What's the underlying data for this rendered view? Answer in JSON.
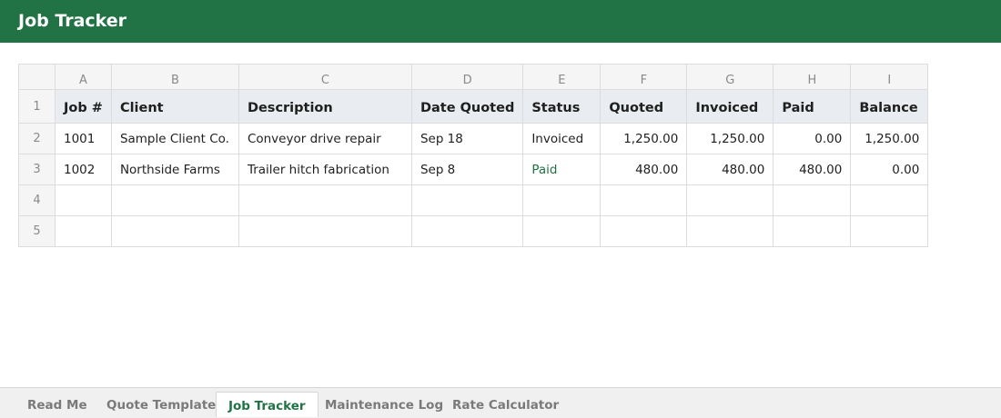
{
  "app": {
    "title": "Job Tracker"
  },
  "colors": {
    "accent": "#217346",
    "paid_status": "#217346"
  },
  "sheet": {
    "column_letters": [
      "A",
      "B",
      "C",
      "D",
      "E",
      "F",
      "G",
      "H",
      "I"
    ],
    "row_numbers": [
      "1",
      "2",
      "3",
      "4",
      "5"
    ],
    "headers": [
      "Job #",
      "Client",
      "Description",
      "Date Quoted",
      "Status",
      "Quoted",
      "Invoiced",
      "Paid",
      "Balance"
    ],
    "rows": [
      [
        "1001",
        "Sample Client Co.",
        "Conveyor drive repair",
        "Sep 18",
        "Invoiced",
        "1,250.00",
        "1,250.00",
        "0.00",
        "1,250.00"
      ],
      [
        "1002",
        "Northside Farms",
        "Trailer hitch fabrication",
        "Sep 8",
        "Paid",
        "480.00",
        "480.00",
        "480.00",
        "0.00"
      ],
      [
        "",
        "",
        "",
        "",
        "",
        "",
        "",
        "",
        ""
      ],
      [
        "",
        "",
        "",
        "",
        "",
        "",
        "",
        "",
        ""
      ]
    ]
  },
  "tabs": [
    {
      "label": "Read Me",
      "active": false
    },
    {
      "label": "Quote Template",
      "active": false
    },
    {
      "label": "Job Tracker",
      "active": true
    },
    {
      "label": "Maintenance Log",
      "active": false
    },
    {
      "label": "Rate Calculator",
      "active": false
    }
  ]
}
